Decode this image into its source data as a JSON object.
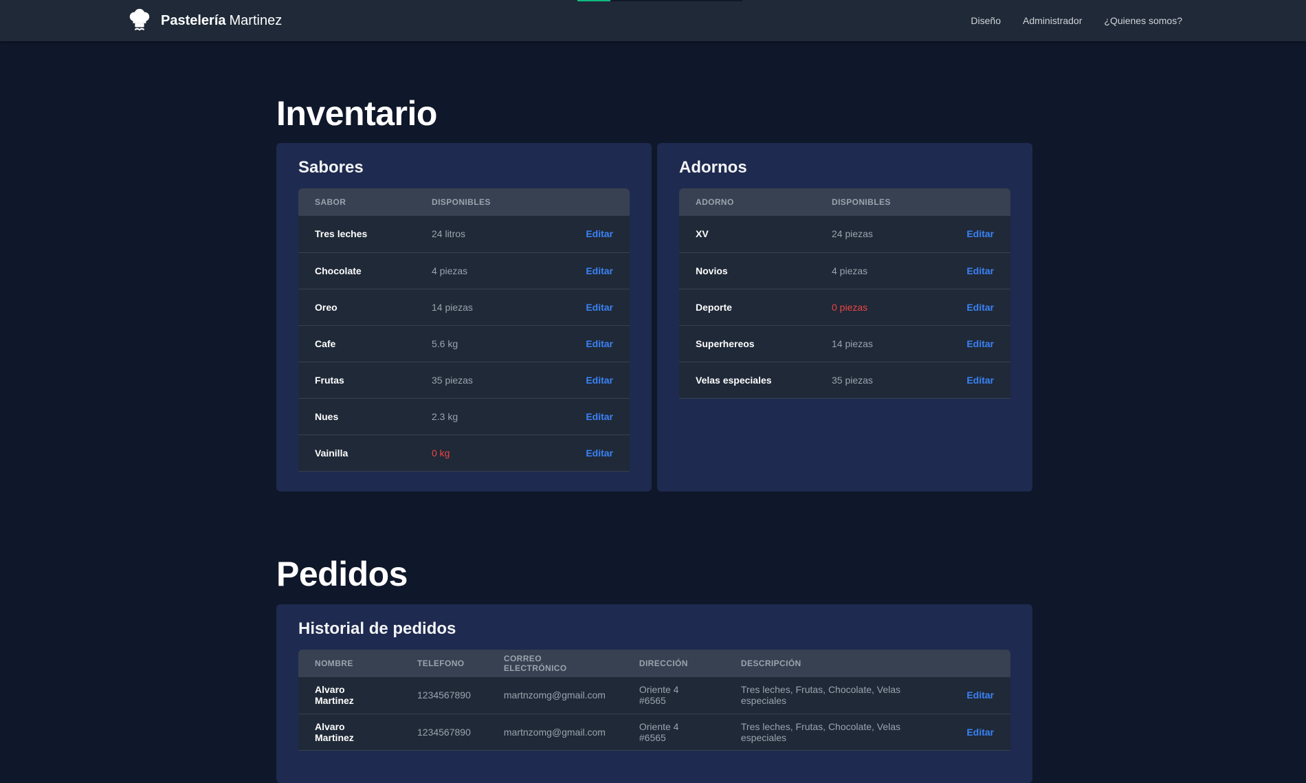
{
  "header": {
    "brand_strong": "Pastelería",
    "brand_light": "Martinez",
    "logo_icon": "chef-hat-icon",
    "nav": [
      "Diseño",
      "Administrador",
      "¿Quienes somos?"
    ]
  },
  "colors": {
    "background": "#0f172a",
    "card": "#1e2a4f",
    "table_row": "#1f2937",
    "table_header": "#374151",
    "link": "#3b82f6",
    "out_of_stock": "#ef4444",
    "accent": "#10b981"
  },
  "inventario": {
    "title": "Inventario",
    "sabores": {
      "title": "Sabores",
      "columns": [
        "Sabor",
        "Disponibles"
      ],
      "rows": [
        {
          "name": "Tres leches",
          "qty": "24 litros",
          "out": false,
          "action": "Editar"
        },
        {
          "name": "Chocolate",
          "qty": "4 piezas",
          "out": false,
          "action": "Editar"
        },
        {
          "name": "Oreo",
          "qty": "14 piezas",
          "out": false,
          "action": "Editar"
        },
        {
          "name": "Cafe",
          "qty": "5.6 kg",
          "out": false,
          "action": "Editar"
        },
        {
          "name": "Frutas",
          "qty": "35 piezas",
          "out": false,
          "action": "Editar"
        },
        {
          "name": "Nues",
          "qty": "2.3 kg",
          "out": false,
          "action": "Editar"
        },
        {
          "name": "Vainilla",
          "qty": "0 kg",
          "out": true,
          "action": "Editar"
        }
      ]
    },
    "adornos": {
      "title": "Adornos",
      "columns": [
        "Adorno",
        "Disponibles"
      ],
      "rows": [
        {
          "name": "XV",
          "qty": "24 piezas",
          "out": false,
          "action": "Editar"
        },
        {
          "name": "Novios",
          "qty": "4 piezas",
          "out": false,
          "action": "Editar"
        },
        {
          "name": "Deporte",
          "qty": "0 piezas",
          "out": true,
          "action": "Editar"
        },
        {
          "name": "Superhereos",
          "qty": "14 piezas",
          "out": false,
          "action": "Editar"
        },
        {
          "name": "Velas especiales",
          "qty": "35 piezas",
          "out": false,
          "action": "Editar"
        }
      ]
    }
  },
  "pedidos": {
    "title": "Pedidos",
    "historial": {
      "title": "Historial de pedidos",
      "columns": [
        "Nombre",
        "Telefono",
        "Correo electrónico",
        "Dirección",
        "Descripción"
      ],
      "rows": [
        {
          "name": "Alvaro Martinez",
          "phone": "1234567890",
          "email": "martnzomg@gmail.com",
          "address": "Oriente 4 #6565",
          "description": "Tres leches, Frutas, Chocolate, Velas especiales",
          "action": "Editar"
        },
        {
          "name": "Alvaro Martinez",
          "phone": "1234567890",
          "email": "martnzomg@gmail.com",
          "address": "Oriente 4 #6565",
          "description": "Tres leches, Frutas, Chocolate, Velas especiales",
          "action": "Editar"
        }
      ]
    }
  }
}
